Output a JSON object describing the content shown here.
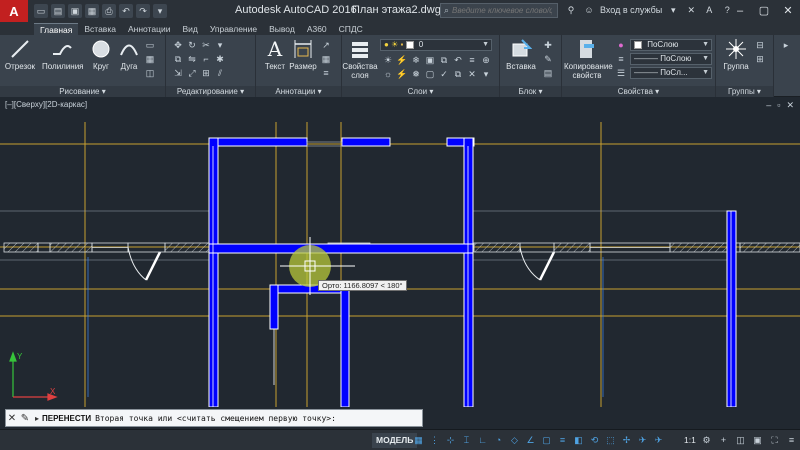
{
  "titlebar": {
    "app_name": "Autodesk AutoCAD 2016",
    "file_name": "План этажа2.dwg",
    "search_placeholder": "Введите ключевое слово/фразу",
    "sign_in": "Вход в службы"
  },
  "tabs": [
    "Главная",
    "Вставка",
    "Аннотации",
    "Вид",
    "Управление",
    "Вывод",
    "A360",
    "СПДС"
  ],
  "ribbon": {
    "panels": {
      "draw": "Рисование",
      "modify": "Редактирование",
      "annotation": "Аннотации",
      "layers": "Слои",
      "block": "Блок",
      "properties": "Свойства",
      "groups": "Группы"
    },
    "tools": {
      "line": "Отрезок",
      "polyline": "Полилиния",
      "circle": "Круг",
      "arc": "Дуга",
      "text": "Текст",
      "dimension": "Размер",
      "layer_properties": "Свойства слоя",
      "insert": "Вставка",
      "match_properties": "Копирование свойств",
      "group": "Группа"
    },
    "layer_current": "0",
    "color_current": "ПоСлою",
    "linetype_current": "ПоСлою",
    "lineweight_current": "ПоСл..."
  },
  "viewport": {
    "label": "[–][Сверху][2D-каркас]",
    "tooltip": "Орто: 1166.8097 < 180°"
  },
  "command": {
    "name": "ПЕРЕНЕСТИ",
    "prompt": "Вторая точка или <считать смещением первую точку>:"
  },
  "statusbar": {
    "model": "МОДЕЛЬ",
    "scale": "1:1"
  },
  "colors": {
    "wall": "#0000ff",
    "grid_axis": "#c8a030",
    "background": "#212830"
  }
}
